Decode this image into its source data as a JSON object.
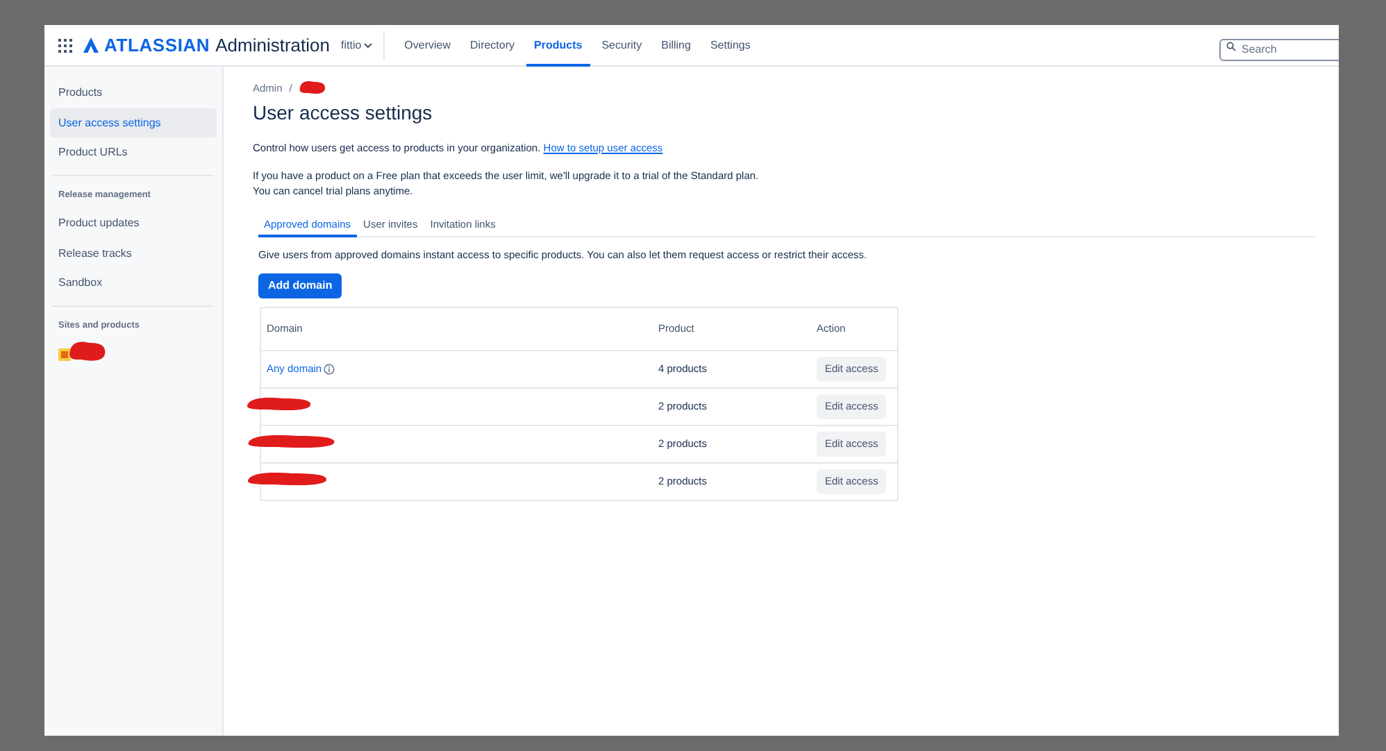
{
  "header": {
    "brand": "ATLASSIAN",
    "product": "Administration",
    "org": "fittio",
    "nav": [
      {
        "label": "Overview",
        "selected": false
      },
      {
        "label": "Directory",
        "selected": false
      },
      {
        "label": "Products",
        "selected": true
      },
      {
        "label": "Security",
        "selected": false
      },
      {
        "label": "Billing",
        "selected": false
      },
      {
        "label": "Settings",
        "selected": false
      }
    ],
    "search": {
      "placeholder": "Search"
    }
  },
  "sidebar": {
    "groups": [
      {
        "items": [
          {
            "label": "Products",
            "selected": false
          },
          {
            "label": "User access settings",
            "selected": true
          },
          {
            "label": "Product URLs",
            "selected": false
          }
        ]
      },
      {
        "heading": "Release management",
        "items": [
          {
            "label": "Product updates",
            "selected": false
          },
          {
            "label": "Release tracks",
            "selected": false
          },
          {
            "label": "Sandbox",
            "selected": false
          }
        ]
      },
      {
        "heading": "Sites and products",
        "sites": [
          {
            "kind": "redacted"
          }
        ]
      }
    ]
  },
  "breadcrumb": [
    "Admin"
  ],
  "breadcrumb_separator": "/",
  "title": "User access settings",
  "intro": {
    "text": "Control how users get access to products in your organization.",
    "link": "How to setup user access"
  },
  "notice": [
    "If you have a product on a Free plan that exceeds the user limit, we'll upgrade it to a trial of the Standard plan.",
    "You can cancel trial plans anytime."
  ],
  "tabs": [
    {
      "label": "Approved domains",
      "selected": true
    },
    {
      "label": "User invites",
      "selected": false
    },
    {
      "label": "Invitation links",
      "selected": false
    }
  ],
  "tab_description": "Give users from approved domains instant access to specific products. You can also let them request access or restrict their access.",
  "add_button": "Add domain",
  "table": {
    "columns": [
      "Domain",
      "Product",
      "Action"
    ],
    "rows": [
      {
        "domain": {
          "kind": "link",
          "text": "Any domain"
        },
        "product": "4 products",
        "action": "Edit access"
      },
      {
        "domain": {
          "kind": "redacted"
        },
        "product": "2 products",
        "action": "Edit access"
      },
      {
        "domain": {
          "kind": "redacted"
        },
        "product": "2 products",
        "action": "Edit access"
      },
      {
        "domain": {
          "kind": "redacted"
        },
        "product": "2 products",
        "action": "Edit access"
      }
    ]
  }
}
